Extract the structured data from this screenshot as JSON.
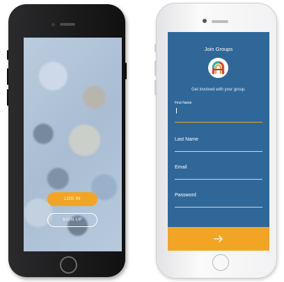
{
  "left_phone": {
    "login_label": "LOG IN",
    "signup_label": "SIGN UP"
  },
  "right_phone": {
    "title": "Join Groups",
    "subtitle": "Get involved with your group.",
    "fields": {
      "first_name": {
        "label": "First Name",
        "value": ""
      },
      "last_name": {
        "label": "Last Name"
      },
      "email": {
        "label": "Email"
      },
      "password": {
        "label": "Password"
      }
    },
    "submit_icon": "arrow-right-icon"
  },
  "colors": {
    "accent": "#f2a524",
    "form_bg": "#2f6799",
    "phone_dark": "#1a1a1b",
    "phone_light": "#f5f5f7"
  }
}
